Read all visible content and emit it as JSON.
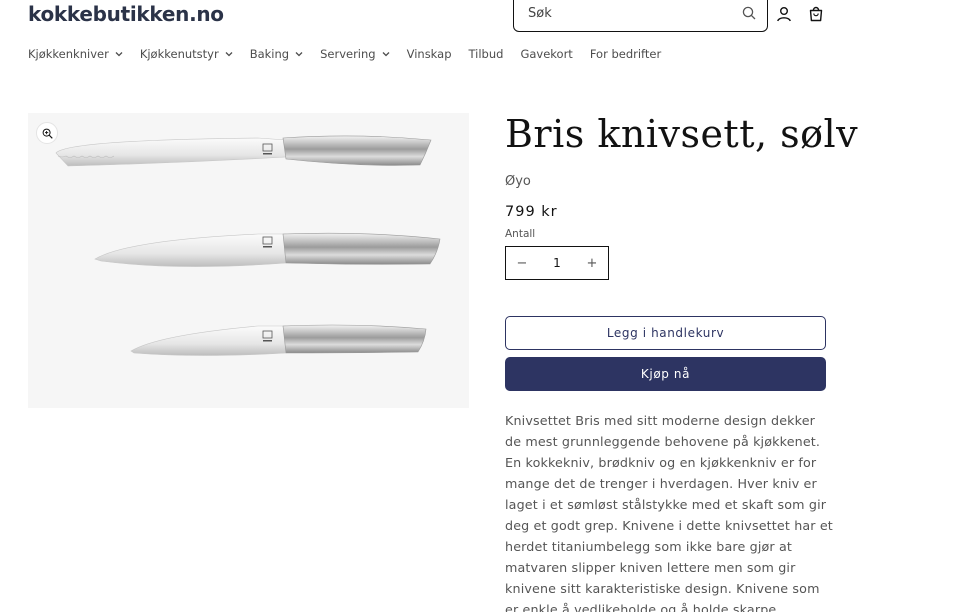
{
  "header": {
    "logo": "kokkebutikken.no",
    "search_placeholder": "Søk",
    "icons": [
      "search-icon",
      "account-icon",
      "cart-icon"
    ]
  },
  "nav": {
    "items": [
      {
        "label": "Kjøkkenkniver",
        "dropdown": true
      },
      {
        "label": "Kjøkkenutstyr",
        "dropdown": true
      },
      {
        "label": "Baking",
        "dropdown": true
      },
      {
        "label": "Servering",
        "dropdown": true
      },
      {
        "label": "Vinskap",
        "dropdown": false
      },
      {
        "label": "Tilbud",
        "dropdown": false
      },
      {
        "label": "Gavekort",
        "dropdown": false
      },
      {
        "label": "For bedrifter",
        "dropdown": false
      }
    ]
  },
  "product": {
    "title": "Bris knivsett, sølv",
    "vendor": "Øyo",
    "price": "799 kr",
    "quantity_label": "Antall",
    "quantity": "1",
    "decrease": "−",
    "increase": "+",
    "add_to_cart": "Legg i handlekurv",
    "buy_now": "Kjøp nå",
    "description": "Knivsettet Bris med sitt moderne design dekker de mest grunnleggende behovene på kjøkkenet. En kokkekniv, brødkniv og en kjøkkenkniv er for mange det de trenger i hverdagen. Hver kniv er laget i et sømløst stålstykke med et skaft som gir deg et godt grep. Knivene i dette knivsettet har et herdet titaniumbelegg som ikke bare gjør at matvaren slipper kniven lettere men som gir knivene sitt karakteristiske design. Knivene som er enkle å vedlikeholde og å holde skarpe."
  },
  "colors": {
    "brand_dark": "#2d3462",
    "logo": "#2b3348",
    "text_muted": "#555555"
  }
}
